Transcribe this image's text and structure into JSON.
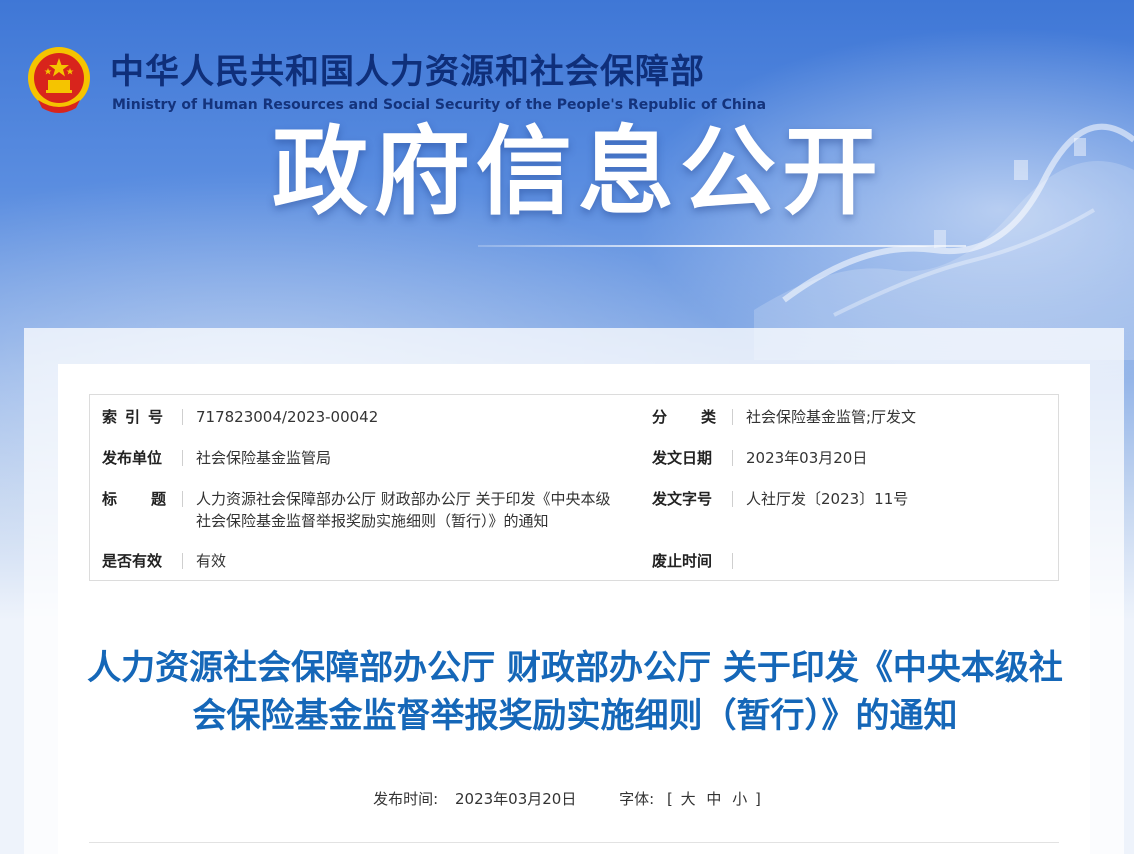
{
  "header": {
    "ministry_name_cn": "中华人民共和国人力资源和社会保障部",
    "ministry_name_en": "Ministry of Human Resources and Social Security of the People's Republic of China",
    "banner_title": "政府信息公开",
    "emblem_icon": "national-emblem-icon"
  },
  "meta": {
    "index_label": "索引号",
    "index_value": "717823004/2023-00042",
    "category_label": "分类",
    "category_value": "社会保险基金监管;厅发文",
    "publisher_label": "发布单位",
    "publisher_value": "社会保险基金监管局",
    "issue_date_label": "发文日期",
    "issue_date_value": "2023年03月20日",
    "title_label": "标题",
    "title_value": "人力资源社会保障部办公厅 财政部办公厅 关于印发《中央本级社会保险基金监督举报奖励实施细则（暂行）》的通知",
    "doc_number_label": "发文字号",
    "doc_number_value": "人社厅发〔2023〕11号",
    "valid_label": "是否有效",
    "valid_value": "有效",
    "expire_label": "废止时间",
    "expire_value": ""
  },
  "article": {
    "title": "人力资源社会保障部办公厅 财政部办公厅 关于印发《中央本级社会保险基金监督举报奖励实施细则（暂行）》的通知",
    "publish_time_label": "发布时间:",
    "publish_time_value": "2023年03月20日",
    "font_label": "字体:",
    "font_bracket_open": "[",
    "font_large": "大",
    "font_medium": "中",
    "font_small": "小",
    "font_bracket_close": "]"
  },
  "colors": {
    "brand_dark": "#0f2f7a",
    "title_blue": "#1567b8",
    "emblem_red": "#d8241c",
    "emblem_gold": "#f5c400"
  }
}
